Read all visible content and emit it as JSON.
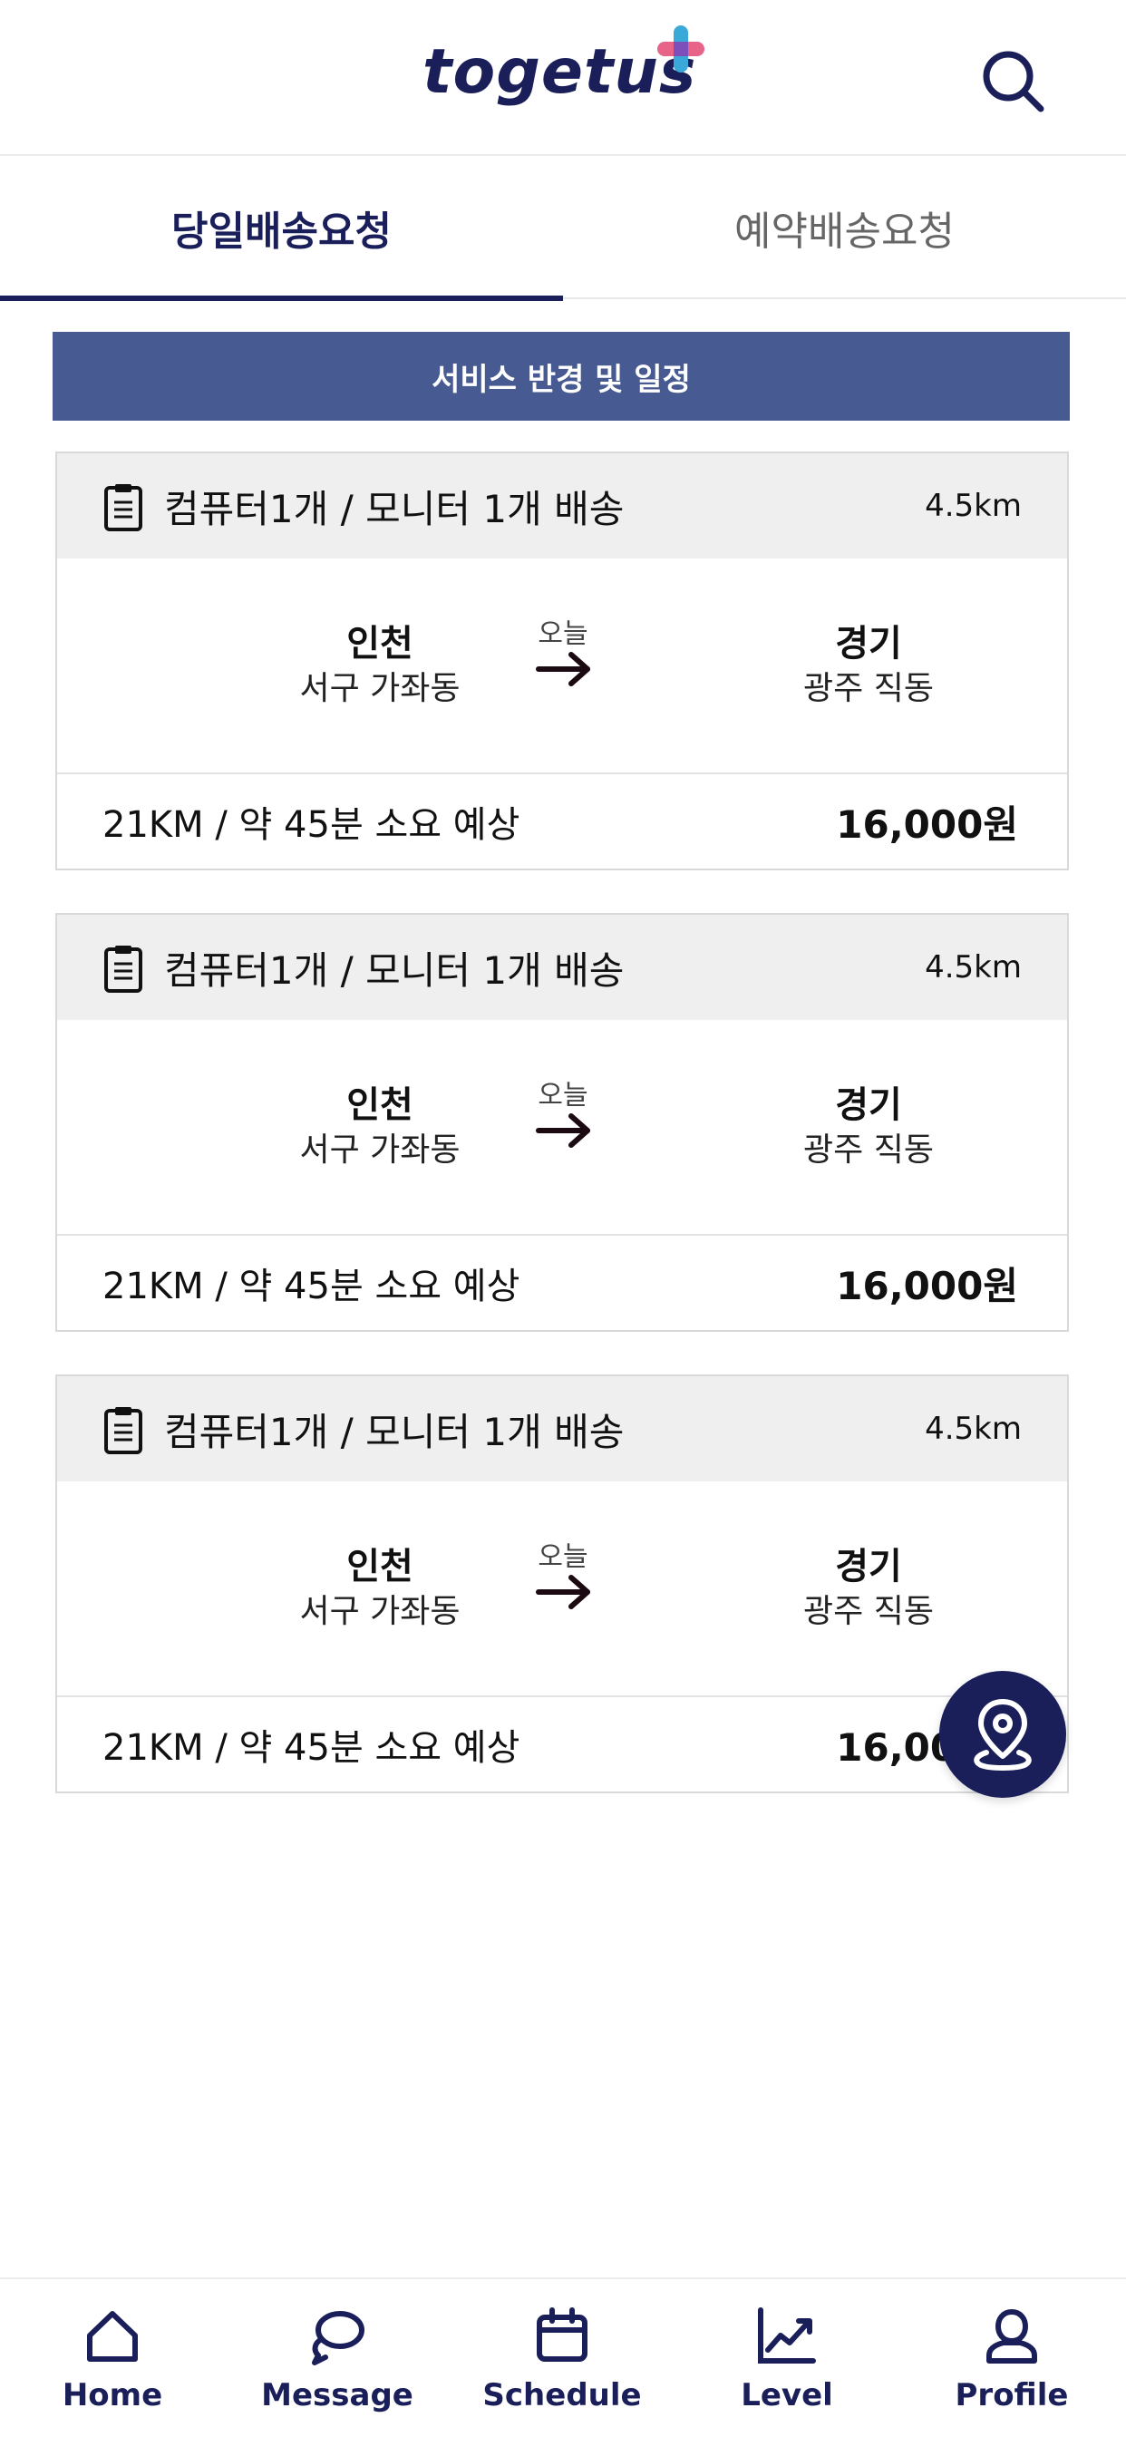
{
  "header": {
    "logo_text": "togetus",
    "search_icon": "search-icon",
    "brand_color": "#1a1f5a",
    "plus_colors": [
      "#e4527a",
      "#3aa9d9",
      "#7d4fb8"
    ]
  },
  "tabs": [
    {
      "label": "당일배송요청",
      "active": true
    },
    {
      "label": "예약배송요청",
      "active": false
    }
  ],
  "banner": {
    "label": "서비스 반경 및 일정",
    "color": "#485a92"
  },
  "cards": [
    {
      "icon": "clipboard-icon",
      "title": "컴퓨터1개 / 모니터 1개 배송",
      "distance": "4.5km",
      "from": {
        "city": "인천",
        "area": "서구 가좌동"
      },
      "when": "오늘",
      "to": {
        "city": "경기",
        "area": "광주 직동"
      },
      "eta": "21KM / 약 45분 소요 예상",
      "price": "16,000원"
    },
    {
      "icon": "clipboard-icon",
      "title": "컴퓨터1개 / 모니터 1개 배송",
      "distance": "4.5km",
      "from": {
        "city": "인천",
        "area": "서구 가좌동"
      },
      "when": "오늘",
      "to": {
        "city": "경기",
        "area": "광주 직동"
      },
      "eta": "21KM / 약 45분 소요 예상",
      "price": "16,000원"
    },
    {
      "icon": "clipboard-icon",
      "title": "컴퓨터1개 / 모니터 1개 배송",
      "distance": "4.5km",
      "from": {
        "city": "인천",
        "area": "서구 가좌동"
      },
      "when": "오늘",
      "to": {
        "city": "경기",
        "area": "광주 직동"
      },
      "eta": "21KM / 약 45분 소요 예상",
      "price": "16,000원"
    }
  ],
  "fab": {
    "icon": "map-pin-icon"
  },
  "bottom_nav": [
    {
      "label": "Home",
      "icon": "home-icon"
    },
    {
      "label": "Message",
      "icon": "message-icon"
    },
    {
      "label": "Schedule",
      "icon": "calendar-icon"
    },
    {
      "label": "Level",
      "icon": "chart-line-icon"
    },
    {
      "label": "Profile",
      "icon": "profile-icon"
    }
  ]
}
